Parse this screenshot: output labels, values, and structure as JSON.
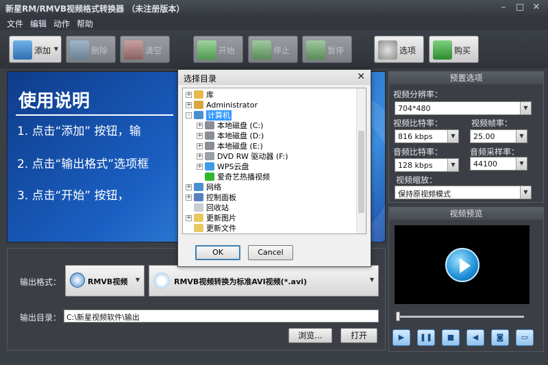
{
  "window": {
    "title": "新星RM/RMVB视频格式转换器 （未注册版本）",
    "controls": [
      "–",
      "□",
      "✕"
    ]
  },
  "menu": [
    "文件",
    "编辑",
    "动作",
    "帮助"
  ],
  "toolbar": {
    "add": "添加",
    "delete": "删除",
    "clear": "清空",
    "start": "开始",
    "stop": "停止",
    "pause": "暂停",
    "options": "选项",
    "buy": "购买"
  },
  "banner": {
    "title": "使用说明",
    "steps": [
      "1. 点击“添加”  按钮，输",
      "2. 点击“输出格式”选项框",
      "3. 点击“开始”  按钮，"
    ]
  },
  "output": {
    "format_label": "输出格式：",
    "format_category": "RMVB视频",
    "format_value": "RMVB视频转换为标准AVI视频(*.avi)",
    "dir_label": "输出目录：",
    "dir_value": "C:\\新星视频软件\\输出",
    "browse": "浏览...",
    "open": "打开"
  },
  "preset": {
    "title": "预置选项",
    "resolution_label": "视频分辨率：",
    "resolution": "704*480",
    "vbitrate_label": "视频比特率：",
    "vbitrate": "816 kbps",
    "fps_label": "视频帧率：",
    "fps": "25.00",
    "abitrate_label": "音频比特率：",
    "abitrate": "128 kbps",
    "samplerate_label": "音频采样率：",
    "samplerate": "44100",
    "scale_label": "视频缩放：",
    "scale": "保持原视频模式"
  },
  "preview": {
    "title": "视频预览"
  },
  "dialog": {
    "title": "选择目录",
    "close": "✕",
    "ok": "OK",
    "cancel": "Cancel",
    "tree": [
      {
        "label": "库",
        "level": 0,
        "expander": "+",
        "icon": "library-icon",
        "color": "#e8b84a"
      },
      {
        "label": "Administrator",
        "level": 0,
        "expander": "+",
        "icon": "user-folder-icon",
        "color": "#d9a640"
      },
      {
        "label": "计算机",
        "level": 0,
        "expander": "-",
        "icon": "computer-icon",
        "color": "#4a8fd0",
        "selected": true
      },
      {
        "label": "本地磁盘 (C:)",
        "level": 1,
        "expander": "+",
        "icon": "drive-icon",
        "color": "#8a8f96"
      },
      {
        "label": "本地磁盘 (D:)",
        "level": 1,
        "expander": "+",
        "icon": "drive-icon",
        "color": "#8a8f96"
      },
      {
        "label": "本地磁盘 (E:)",
        "level": 1,
        "expander": "+",
        "icon": "drive-icon",
        "color": "#8a8f96"
      },
      {
        "label": "DVD RW 驱动器 (F:)",
        "level": 1,
        "expander": "+",
        "icon": "dvd-icon",
        "color": "#9aa0a6"
      },
      {
        "label": "WPS云盘",
        "level": 1,
        "expander": "+",
        "icon": "cloud-icon",
        "color": "#3f9be8"
      },
      {
        "label": "爱奇艺热播视频",
        "level": 1,
        "expander": "",
        "icon": "iqiyi-icon",
        "color": "#2eb82e"
      },
      {
        "label": "网络",
        "level": 0,
        "expander": "+",
        "icon": "network-icon",
        "color": "#4a8fd0"
      },
      {
        "label": "控制面板",
        "level": 0,
        "expander": "+",
        "icon": "control-panel-icon",
        "color": "#5a7fbf"
      },
      {
        "label": "回收站",
        "level": 0,
        "expander": "",
        "icon": "recycle-bin-icon",
        "color": "#c9ccd0"
      },
      {
        "label": "更新图片",
        "level": 0,
        "expander": "+",
        "icon": "folder-icon",
        "color": "#e8c860"
      },
      {
        "label": "更新文件",
        "level": 0,
        "expander": "",
        "icon": "folder-icon",
        "color": "#e8c860"
      }
    ]
  }
}
